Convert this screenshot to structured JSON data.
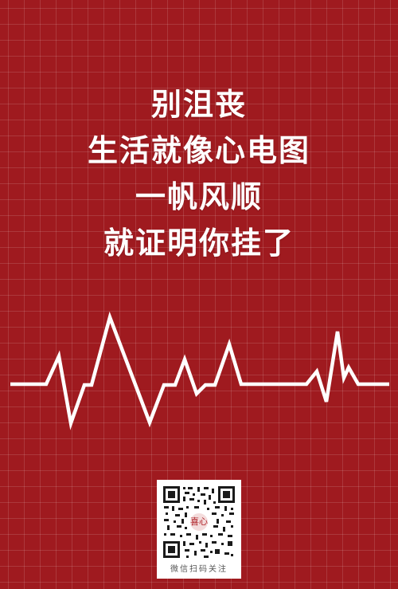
{
  "headline": {
    "lines": [
      "别沮丧",
      "生活就像心电图",
      "一帆风顺",
      "就证明你挂了"
    ]
  },
  "qr": {
    "caption": "微信扫码关注",
    "logo_text": "喜心"
  },
  "colors": {
    "background": "#9f1a1f",
    "text": "#ffffff",
    "ecg_line": "#ffffff"
  }
}
